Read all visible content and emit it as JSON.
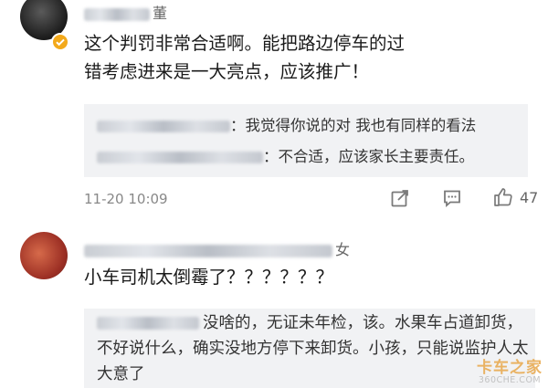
{
  "comment1": {
    "username_visible": "董",
    "text": "这个判罚非常合适啊。能把路边停车的过错考虑进来是一大亮点，应该推广！",
    "replies": [
      {
        "text": "：我觉得你说的对 我也有同样的看法"
      },
      {
        "text": "：不合适，应该家长主要责任。"
      }
    ],
    "timestamp": "11-20 10:09",
    "like_count": "47",
    "icons": [
      "share-icon",
      "comment-icon",
      "thumbs-up-icon",
      "verified-badge-icon"
    ]
  },
  "comment2": {
    "username_visible": "女",
    "text": "小车司机太倒霉了？？？？？？",
    "reply": {
      "text": "没啥的，无证未年检，该。水果车占道卸货，不好说什么，确实没地方停下来卸货。小孩，只能说监护人太大意了"
    }
  },
  "watermark": {
    "main": "卡车之家",
    "sub": "360CHE.COM"
  },
  "colors": {
    "reply_bg": "#f1f2f4",
    "verified_badge": "#f3a91b",
    "meta_gray": "#888888"
  }
}
